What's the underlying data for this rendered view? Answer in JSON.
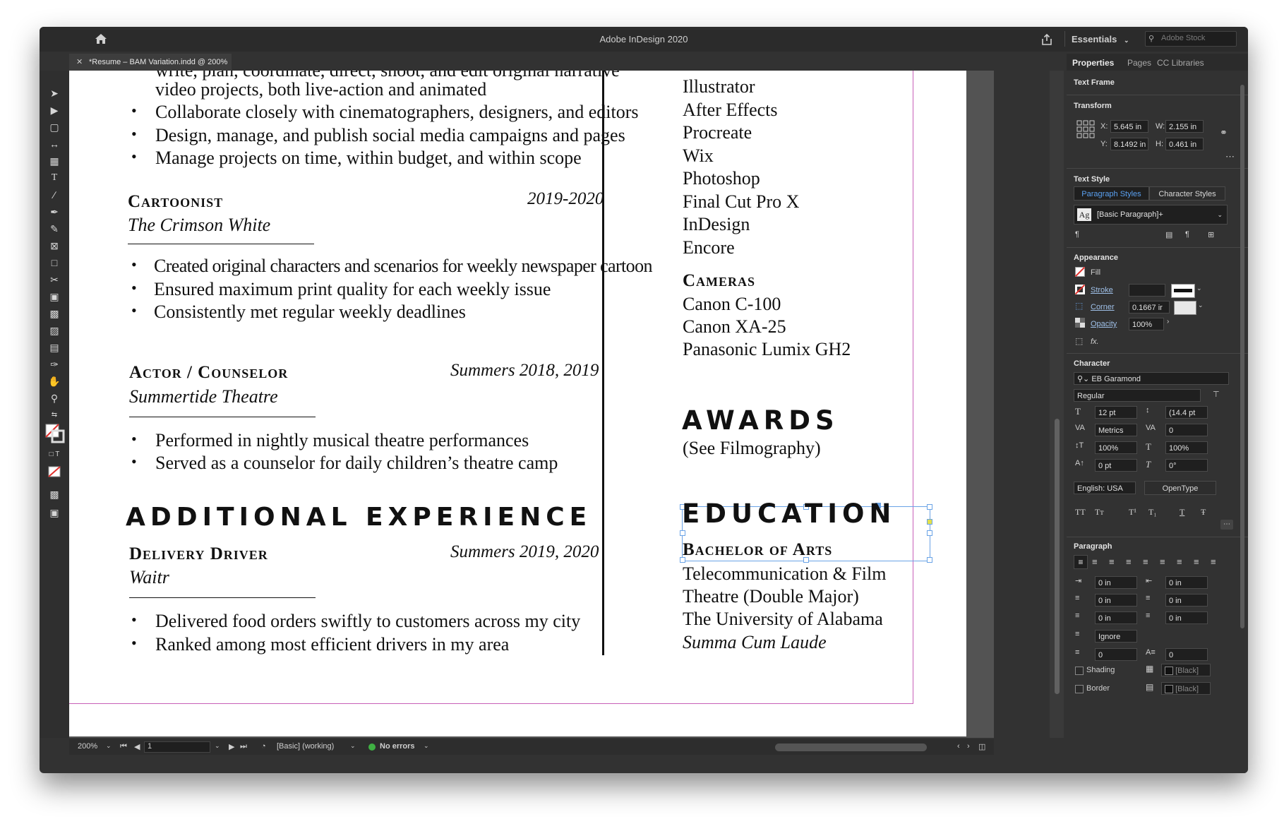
{
  "app": {
    "title": "Adobe InDesign 2020",
    "workspace": "Essentials",
    "search_placeholder": "Adobe Stock",
    "document_tab": "*Resume – BAM Variation.indd @ 200%"
  },
  "document": {
    "top_cut_line": "write, plan, coordinate, direct, shoot, and edit original narrative",
    "left_lines": [
      "video projects, both live-action and animated",
      "Collaborate closely with cinematographers, designers, and editors",
      "Design, manage, and publish social media campaigns and pages",
      "Manage projects on time, within budget, and within scope"
    ],
    "cartoonist": {
      "title": "Cartoonist",
      "date": "2019-2020",
      "org": "The Crimson White",
      "bullets": [
        "Created original characters and scenarios for weekly newspaper cartoon",
        "Ensured maximum print quality for each weekly issue",
        "Consistently met regular weekly deadlines"
      ]
    },
    "actor": {
      "title": "Actor / Counselor",
      "date": "Summers 2018, 2019",
      "org": "Summertide Theatre",
      "bullets": [
        "Performed in nightly musical theatre performances",
        "Served as a counselor for daily children’s theatre camp"
      ]
    },
    "additional_heading": "ADDITIONAL EXPERIENCE",
    "driver": {
      "title": "Delivery Driver",
      "date": "Summers 2019, 2020",
      "org": "Waitr",
      "bullets": [
        "Delivered food orders swiftly to customers across my city",
        "Ranked among most efficient drivers in my area"
      ]
    },
    "software": [
      "Illustrator",
      "After Effects",
      "Procreate",
      "Wix",
      "Photoshop",
      "Final Cut Pro X",
      "InDesign",
      "Encore"
    ],
    "cameras_heading": "Cameras",
    "cameras": [
      "Canon C-100",
      "Canon XA-25",
      "Panasonic Lumix GH2"
    ],
    "awards_heading": "AWARDS",
    "awards_text": "(See Filmography)",
    "education_heading": "EDUCATION",
    "degree": "Bachelor of Arts",
    "education_lines": [
      "Telecommunication & Film",
      "Theatre (Double Major)",
      "The University of Alabama"
    ],
    "honor": "Summa Cum Laude"
  },
  "status": {
    "zoom": "200%",
    "page": "1",
    "profile": "[Basic] (working)",
    "errors": "No errors"
  },
  "panel": {
    "tabs": [
      "Properties",
      "Pages",
      "CC Libraries"
    ],
    "selection_type": "Text Frame",
    "transform": {
      "label": "Transform",
      "x_label": "X:",
      "x": "5.645 in",
      "y_label": "Y:",
      "y": "8.1492 in",
      "w_label": "W:",
      "w": "2.155 in",
      "h_label": "H:",
      "h": "0.461 in"
    },
    "text_style": {
      "label": "Text Style",
      "tab_paragraph": "Paragraph Styles",
      "tab_character": "Character Styles",
      "style_icon": "Ag",
      "current_style": "[Basic Paragraph]+"
    },
    "appearance": {
      "label": "Appearance",
      "fill": "Fill",
      "stroke": "Stroke",
      "corner": "Corner",
      "corner_value": "0.1667 ir",
      "opacity": "Opacity",
      "opacity_value": "100%",
      "fx": "fx."
    },
    "character": {
      "label": "Character",
      "font": "EB Garamond",
      "style": "Regular",
      "size": "12 pt",
      "leading": "(14.4 pt",
      "kerning": "Metrics",
      "tracking": "0",
      "vscale": "100%",
      "hscale": "100%",
      "baseline": "0 pt",
      "skew": "0°",
      "language": "English: USA",
      "opentype": "OpenType",
      "caps_buttons": [
        "TT",
        "Tт",
        "T¹",
        "T₁",
        "T",
        "Ŧ"
      ]
    },
    "paragraph": {
      "label": "Paragraph",
      "left_indent": "0 in",
      "right_indent": "0 in",
      "first_indent": "0 in",
      "last_indent": "0 in",
      "space_before": "0 in",
      "space_after": "0 in",
      "grid_align": "Ignore",
      "drop_lines": "0",
      "drop_chars": "0",
      "shading": "Shading",
      "border": "Border",
      "swatch": "[Black]"
    }
  }
}
